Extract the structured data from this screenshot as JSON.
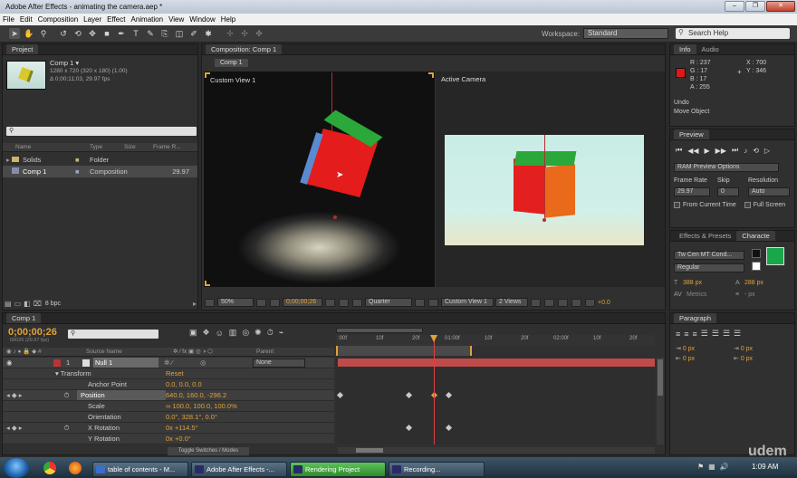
{
  "window": {
    "title": "Adobe After Effects - animating the camera.aep *",
    "min": "–",
    "max": "❐",
    "close": "✕"
  },
  "menu": [
    "File",
    "Edit",
    "Composition",
    "Layer",
    "Effect",
    "Animation",
    "View",
    "Window",
    "Help"
  ],
  "toolbar": {
    "workspace_label": "Workspace:",
    "workspace_value": "Standard",
    "search_placeholder": "Search Help"
  },
  "project": {
    "tab": "Project",
    "comp_name": "Comp 1 ▾",
    "comp_size": "1280 x 720  (320 x 180) (1.00)",
    "comp_dur": "Δ 0;00;11;03, 29.97 fps",
    "cols": [
      "Name",
      "Type",
      "Size",
      "Frame R..."
    ],
    "items": [
      {
        "name": "Solids",
        "type": "Folder",
        "size": "",
        "fr": ""
      },
      {
        "name": "Comp 1",
        "type": "Composition",
        "size": "",
        "fr": "29.97"
      }
    ],
    "bpc": "8 bpc"
  },
  "composition": {
    "tab": "Composition: Comp 1",
    "subtab": "Comp 1",
    "left_view_label": "Custom View 1",
    "right_view_label": "Active Camera",
    "footer": {
      "zoom": "50%",
      "timecode": "0;00;00;26",
      "resolution": "Quarter",
      "view": "Custom View 1",
      "views": "2 Views",
      "exposure": "+0.0"
    }
  },
  "info": {
    "tabs": [
      "Info",
      "Audio"
    ],
    "r": "R : 237",
    "g": "G : 17",
    "b": "B : 17",
    "a": "A : 255",
    "x": "X : 700",
    "y": "Y : 346",
    "undo": "Undo",
    "action": "Move Object",
    "swatch": "#e01818"
  },
  "preview": {
    "tab": "Preview",
    "mode": "RAM Preview Options",
    "frame_rate_label": "Frame Rate",
    "frame_rate": "29.97",
    "skip_label": "Skip",
    "skip": "0",
    "resolution_label": "Resolution",
    "resolution": "Auto",
    "from_current": "From Current Time",
    "full_screen": "Full Screen"
  },
  "character": {
    "tabs": [
      "Effects & Presets",
      "Characte"
    ],
    "font": "Tw Cen MT Cond...",
    "style": "Regular",
    "size": "388 px",
    "leading": "288 px",
    "kerning": "Metrics",
    "stroke": "- px",
    "fill_color": "#1aa64a"
  },
  "paragraph": {
    "tab": "Paragraph",
    "vals": [
      "0 px",
      "0 px",
      "0 px",
      "0 px",
      "0 px"
    ]
  },
  "timeline": {
    "tab": "Comp 1",
    "timecode": "0;00;00;26",
    "fps": "00026 (29.97 fps)",
    "cols": {
      "source": "Source Name",
      "parent": "Parent"
    },
    "ruler": [
      ":00f",
      "10f",
      "20f",
      "01:00f",
      "10f",
      "20f",
      "02:00f",
      "10f",
      "20f"
    ],
    "layer": {
      "num": "1",
      "name": "Null 1",
      "parent": "None"
    },
    "props": [
      {
        "name": "Transform",
        "value": "Reset"
      },
      {
        "name": "Anchor Point",
        "value": "0.0, 0.0, 0.0"
      },
      {
        "name": "Position",
        "value": "640.0, 160.0, -296.2"
      },
      {
        "name": "Scale",
        "value": "∞ 100.0, 100.0, 100.0%"
      },
      {
        "name": "Orientation",
        "value": "0.0°, 328.1°, 0.0°"
      },
      {
        "name": "X Rotation",
        "value": "0x +114.5°"
      },
      {
        "name": "Y Rotation",
        "value": "0x +0.0°"
      },
      {
        "name": "Z Rotation",
        "value": ""
      }
    ],
    "toggle": "Toggle Switches / Modes"
  },
  "taskbar": {
    "items": [
      {
        "label": "table of contents - M...",
        "color": "#3b6fc9"
      },
      {
        "label": "Adobe After Effects -...",
        "color": "#2a2a6a"
      },
      {
        "label": "Rendering Project",
        "color": "#2a2a6a"
      },
      {
        "label": "Recording...",
        "color": "#2a2a6a"
      }
    ],
    "clock": "1:09 AM",
    "watermark": "udem"
  }
}
